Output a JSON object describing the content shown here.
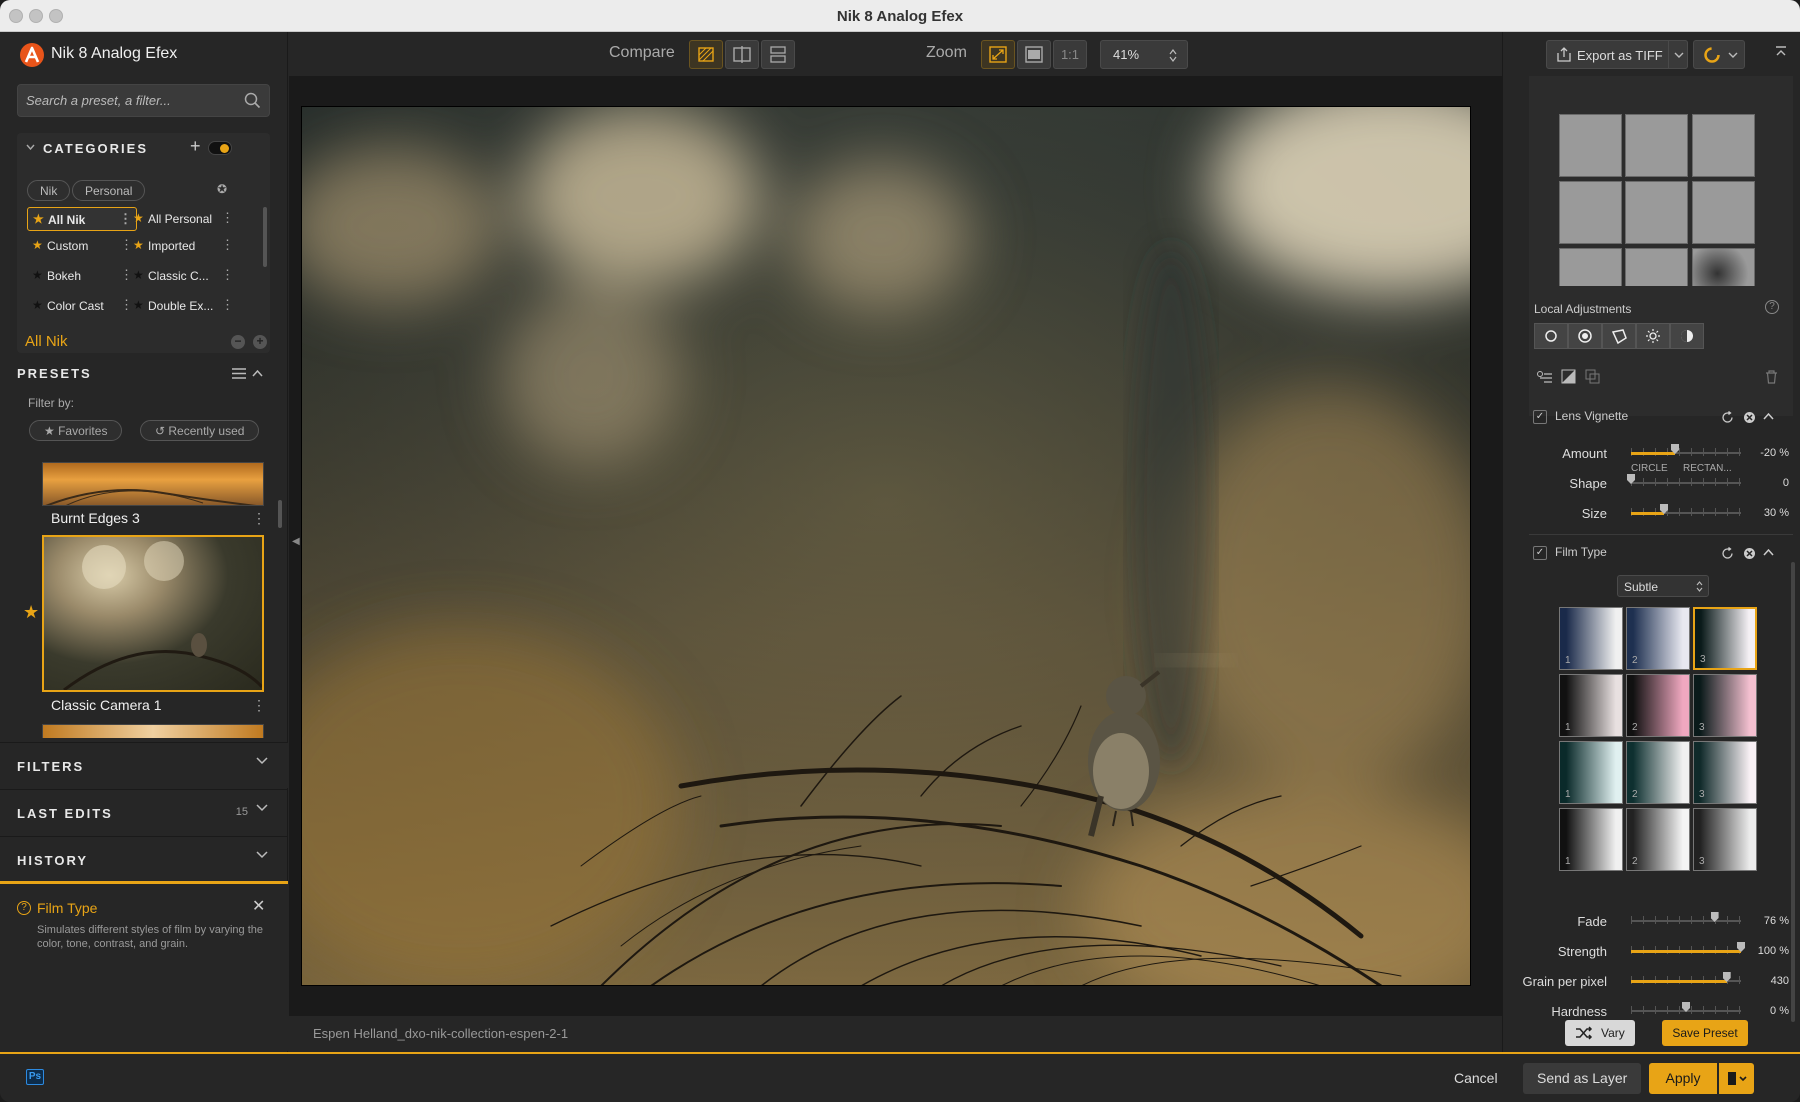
{
  "window": {
    "title": "Nik 8 Analog Efex"
  },
  "app": {
    "name": "Nik 8 Analog Efex"
  },
  "search": {
    "placeholder": "Search a preset, a filter..."
  },
  "categories": {
    "title": "CATEGORIES",
    "tabs": [
      "Nik",
      "Personal"
    ],
    "items": [
      {
        "label": "All Nik",
        "selected": true
      },
      {
        "label": "All Personal"
      },
      {
        "label": "Custom"
      },
      {
        "label": "Imported"
      },
      {
        "label": "Bokeh"
      },
      {
        "label": "Classic C..."
      },
      {
        "label": "Color Cast"
      },
      {
        "label": "Double Ex..."
      }
    ]
  },
  "presets": {
    "current_category": "All Nik",
    "title": "PRESETS",
    "filter_by": "Filter by:",
    "filters": [
      "Favorites",
      "Recently used"
    ],
    "items": [
      {
        "name": "Burnt Edges 3"
      },
      {
        "name": "Classic Camera 1",
        "favorite": true,
        "selected": true
      }
    ]
  },
  "sections": {
    "filters": "FILTERS",
    "last_edits": "LAST EDITS",
    "last_edits_count": "15",
    "history": "HISTORY"
  },
  "help": {
    "title": "Film Type",
    "text": "Simulates different styles of film by varying the color, tone, contrast, and grain."
  },
  "toolbar": {
    "compare_label": "Compare",
    "zoom_label": "Zoom",
    "zoom_1to1": "1:1",
    "zoom_value": "41%",
    "export_label": "Export as TIFF"
  },
  "image": {
    "filename": "Espen Helland_dxo-nik-collection-espen-2-1"
  },
  "local_adjustments": {
    "title": "Local Adjustments"
  },
  "lens_vignette": {
    "title": "Lens Vignette",
    "amount": {
      "label": "Amount",
      "value": "-20 %",
      "fraction": 0.4
    },
    "shape": {
      "label": "Shape",
      "value": "0",
      "left": "CIRCLE",
      "right": "RECTAN...",
      "fraction": 0.0
    },
    "size": {
      "label": "Size",
      "value": "30 %",
      "fraction": 0.3
    }
  },
  "film_type": {
    "title": "Film Type",
    "mode": "Subtle",
    "selected_index": 2,
    "fade": {
      "label": "Fade",
      "value": "76 %",
      "fraction": 0.76
    },
    "strength": {
      "label": "Strength",
      "value": "100 %",
      "fraction": 1.0
    },
    "grain": {
      "label": "Grain per pixel",
      "value": "430",
      "fraction": 0.87
    },
    "hardness": {
      "label": "Hardness",
      "value": "0 %",
      "fraction": 0.5
    }
  },
  "right_actions": {
    "vary": "Vary",
    "save_preset": "Save Preset"
  },
  "bottom": {
    "cancel": "Cancel",
    "send_as_layer": "Send as Layer",
    "apply": "Apply",
    "ps_badge": "Ps"
  },
  "colors": {
    "accent": "#e8a416",
    "panel": "#262626",
    "canvas": "#1a1a1a"
  }
}
